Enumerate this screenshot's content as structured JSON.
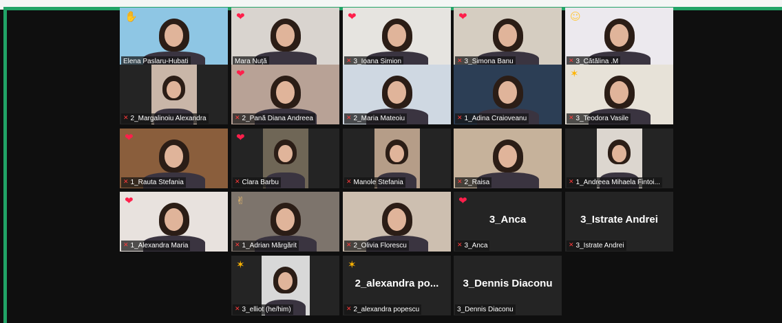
{
  "meeting": {
    "participants": [
      {
        "name": "Elena Paslaru-Hubati",
        "muted": false,
        "reaction": "wave-icon",
        "active": true,
        "bg": "#8ec6e4"
      },
      {
        "name": "Mara Nuță",
        "muted": false,
        "reaction": "heart-icon",
        "bg": "#d9d4cf"
      },
      {
        "name": "3_Ioana Simion",
        "muted": true,
        "reaction": "heart-icon",
        "bg": "#e6e4e0"
      },
      {
        "name": "3_Simona Banu",
        "muted": true,
        "reaction": "heart-icon",
        "bg": "#d5cdc1"
      },
      {
        "name": "3_Cătălina .M",
        "muted": true,
        "reaction": "heart-eyes-icon",
        "bg": "#ece9ee"
      },
      {
        "name": "2_Margalinoiu Alexandra",
        "muted": true,
        "reaction": "",
        "bg": "#c9b6a8"
      },
      {
        "name": "2_Pană Diana Andreea",
        "muted": true,
        "reaction": "heart-icon",
        "bg": "#b8a296"
      },
      {
        "name": "2_Maria Mateoiu",
        "muted": true,
        "reaction": "",
        "bg": "#cfd8e2"
      },
      {
        "name": "1_Adina Craioveanu",
        "muted": true,
        "reaction": "",
        "bg": "#2c3e55"
      },
      {
        "name": "3_Teodora Vasile",
        "muted": true,
        "reaction": "party-icon",
        "bg": "#e7e2d8"
      },
      {
        "name": "1_Rauta Stefania",
        "muted": true,
        "reaction": "heart-icon",
        "bg": "#8a5e3c"
      },
      {
        "name": "Clara Barbu",
        "muted": true,
        "reaction": "heart-icon",
        "bg": "#6f6656"
      },
      {
        "name": "Manole Stefania",
        "muted": true,
        "reaction": "",
        "bg": "#b59d88"
      },
      {
        "name": "2_Raisa",
        "muted": true,
        "reaction": "",
        "bg": "#c6b29b"
      },
      {
        "name": "1_Andreea Mihaela Fintoi...",
        "muted": true,
        "reaction": "",
        "bg": "#dcd6cf"
      },
      {
        "name": "1_Alexandra Maria",
        "muted": true,
        "reaction": "heart-icon",
        "bg": "#e8e2de"
      },
      {
        "name": "1_Adrian Mărgărit",
        "muted": true,
        "reaction": "thumbs-up-icon",
        "bg": "#7d746c"
      },
      {
        "name": "2_Olivia Florescu",
        "muted": true,
        "reaction": "",
        "bg": "#cdbfb0"
      },
      {
        "name": "3_Anca",
        "muted": true,
        "reaction": "heart-icon",
        "display": "3_Anca",
        "video": false
      },
      {
        "name": "3_Istrate Andrei",
        "muted": true,
        "reaction": "",
        "display": "3_Istrate Andrei",
        "video": false
      },
      {
        "name": "3_elliot (he/him)",
        "muted": true,
        "reaction": "party-icon",
        "bg": "#d8d8d8"
      },
      {
        "name": "2_alexandra popescu",
        "muted": true,
        "reaction": "party-icon",
        "display": "2_alexandra  po...",
        "video": false
      },
      {
        "name": "3_Dennis Diaconu",
        "muted": false,
        "reaction": "",
        "display": "3_Dennis Diaconu",
        "video": false
      }
    ]
  },
  "colors": {
    "accent": "#21a366",
    "muted_mic": "#ff3a3a",
    "active_speaker": "#e5e04a",
    "tile_bg": "#242424"
  }
}
